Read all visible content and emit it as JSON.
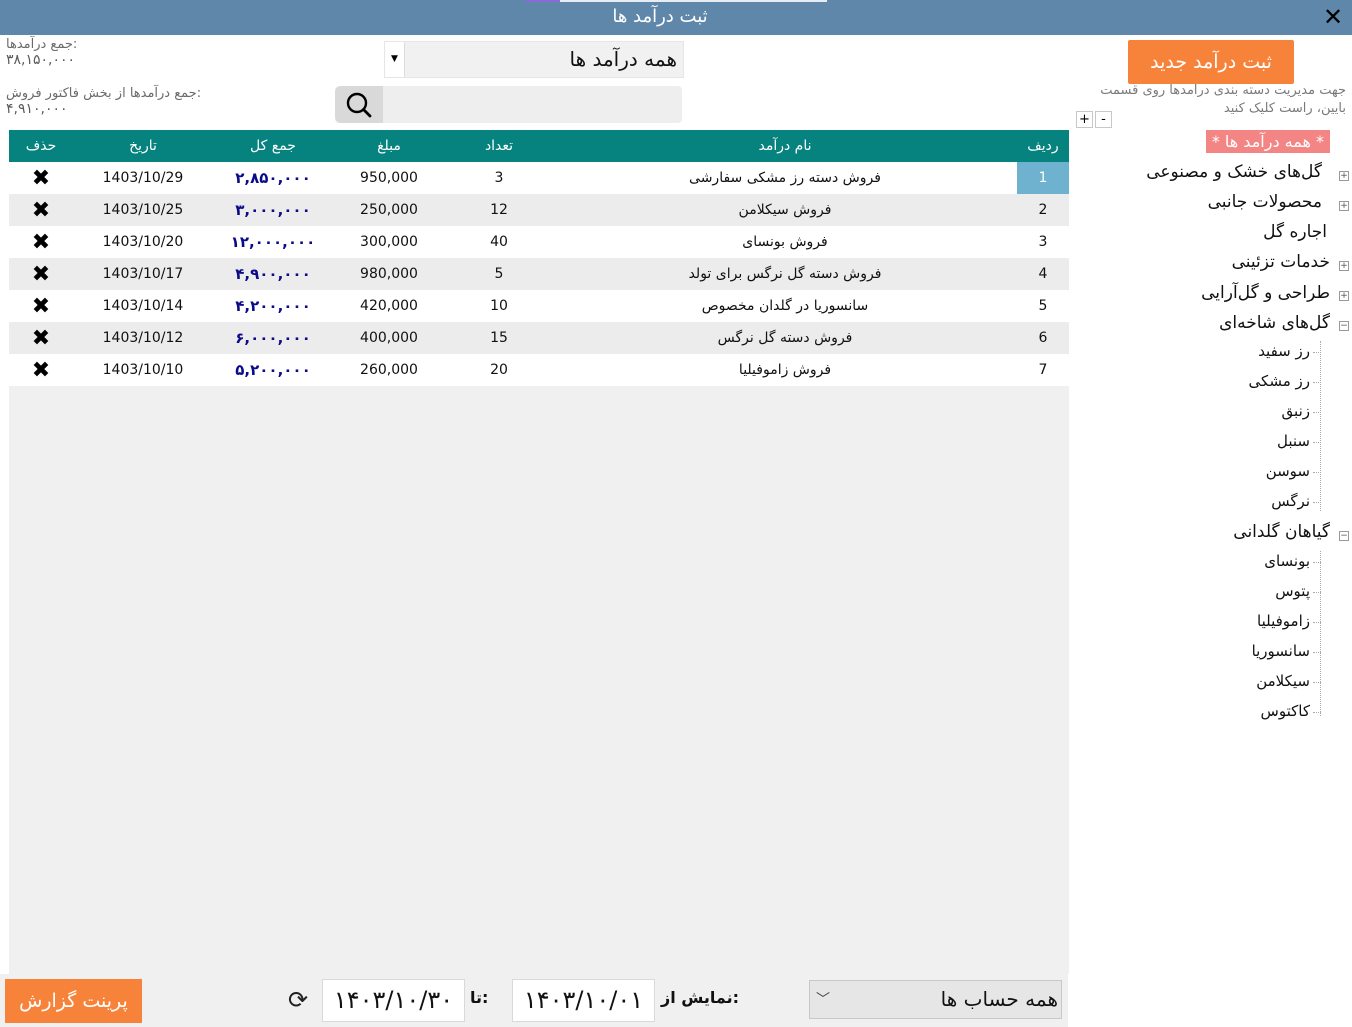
{
  "window": {
    "title": "ثبت درآمد ها"
  },
  "summary": {
    "total_label": "جمع درآمدها:",
    "total_value": "۳۸,۱۵۰,۰۰۰",
    "invoice_label": "جمع درآمدها از بخش فاکتور فروش:",
    "invoice_value": "۴,۹۱۰,۰۰۰"
  },
  "filter": {
    "category_selected": "همه درآمد ها",
    "search_placeholder": ""
  },
  "actions": {
    "new_income": "ثبت درآمد جدید",
    "hint": "جهت مدیریت دسته بندی درامدها روی قسمت بایین، راست کلیک کنید",
    "plus": "+",
    "minus": "-"
  },
  "table": {
    "headers": {
      "row": "ردیف",
      "name": "نام درآمد",
      "qty": "تعداد",
      "amount": "مبلغ",
      "total": "جمع کل",
      "date": "تاریخ",
      "delete": "حذف"
    },
    "rows": [
      {
        "row": "1",
        "name": "فروش دسته رز مشکی سفارشی",
        "qty": "3",
        "amount": "950,000",
        "total": "۲,۸۵۰,۰۰۰",
        "date": "1403/10/29"
      },
      {
        "row": "2",
        "name": "فروش سیکلامن",
        "qty": "12",
        "amount": "250,000",
        "total": "۳,۰۰۰,۰۰۰",
        "date": "1403/10/25"
      },
      {
        "row": "3",
        "name": "فروش بونسای",
        "qty": "40",
        "amount": "300,000",
        "total": "۱۲,۰۰۰,۰۰۰",
        "date": "1403/10/20"
      },
      {
        "row": "4",
        "name": "فروش دسته گل نرگس برای تولد",
        "qty": "5",
        "amount": "980,000",
        "total": "۴,۹۰۰,۰۰۰",
        "date": "1403/10/17"
      },
      {
        "row": "5",
        "name": "سانسوریا در گلدان مخصوص",
        "qty": "10",
        "amount": "420,000",
        "total": "۴,۲۰۰,۰۰۰",
        "date": "1403/10/14"
      },
      {
        "row": "6",
        "name": "فروش دسته گل نرگس",
        "qty": "15",
        "amount": "400,000",
        "total": "۶,۰۰۰,۰۰۰",
        "date": "1403/10/12"
      },
      {
        "row": "7",
        "name": "فروش زاموفیلیا",
        "qty": "20",
        "amount": "260,000",
        "total": "۵,۲۰۰,۰۰۰",
        "date": "1403/10/10"
      }
    ]
  },
  "tree": {
    "root": "* همه درآمد ها *",
    "nodes": [
      "گل‌های خشک و مصنوعی",
      "محصولات جانبی",
      "اجاره گل",
      "خدمات تزئینی",
      "طراحی و گل‌آرایی",
      "گل‌های شاخه‌ای",
      "گیاهان گلدانی"
    ],
    "cut_flowers": [
      "رز سفید",
      "رز مشکی",
      "زنبق",
      "سنبل",
      "سوسن",
      "نرگس"
    ],
    "pot_plants": [
      "بونسای",
      "پتوس",
      "زاموفیلیا",
      "سانسوریا",
      "سیکلامن",
      "کاکتوس"
    ]
  },
  "footer": {
    "print": "پرینت گزارش",
    "to_label": "تا:",
    "to_date": "۱۴۰۳/۱۰/۳۰",
    "from_label": "نمایش از:",
    "from_date": "۱۴۰۳/۱۰/۰۱",
    "account": "همه حساب ها"
  }
}
